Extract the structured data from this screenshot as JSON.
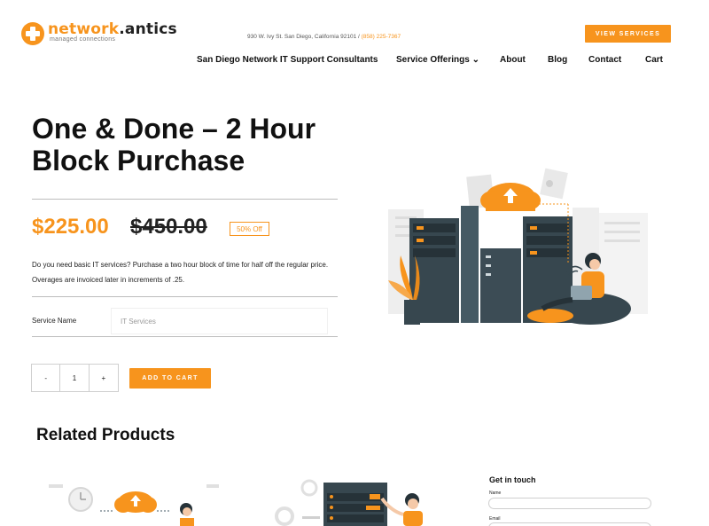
{
  "header": {
    "logo_name_part1": "network",
    "logo_name_part2": ".antics",
    "logo_tagline": "managed connections",
    "address": "930 W. Ivy St. San Diego, California 92101 / ",
    "phone": "(858) 225-7367",
    "cta_label": "VIEW SERVICES"
  },
  "nav": {
    "items": [
      {
        "label": "San Diego Network IT Support Consultants"
      },
      {
        "label": "Service Offerings ⌄"
      },
      {
        "label": "About"
      },
      {
        "label": "Blog"
      },
      {
        "label": "Contact"
      },
      {
        "label": "Cart"
      }
    ]
  },
  "product": {
    "title": "One & Done – 2 Hour Block Purchase",
    "price": "$225.00",
    "old_price": "$450.00",
    "discount_badge": "50% Off",
    "description": "Do you need basic IT services? Purchase a two hour block of time for half off the regular price.  Overages are invoiced later in increments of .25.",
    "service_label": "Service Name",
    "service_value": "IT Services",
    "qty_minus": "-",
    "qty_value": "1",
    "qty_plus": "+",
    "add_to_cart_label": "ADD TO CART"
  },
  "related": {
    "heading": "Related Products"
  },
  "contact": {
    "title": "Get in touch",
    "name_label": "Name",
    "email_label": "Email"
  },
  "colors": {
    "accent": "#f7941d",
    "text": "#111111",
    "illustration_dark": "#37474f"
  }
}
